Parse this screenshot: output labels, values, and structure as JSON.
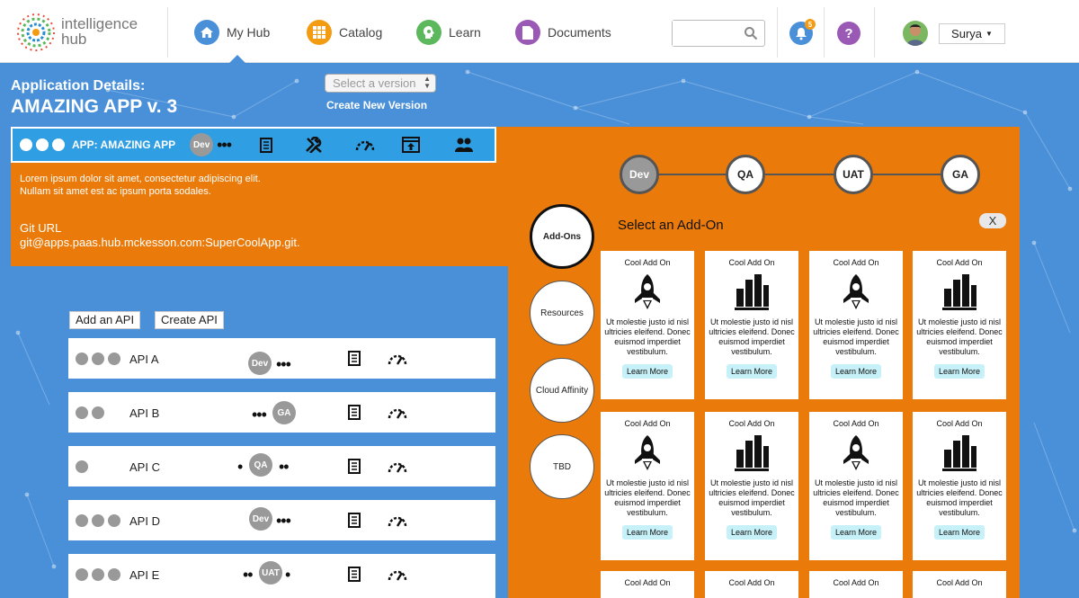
{
  "brand": {
    "line1": "intelligence",
    "line2": "hub"
  },
  "nav": [
    {
      "label": "My Hub",
      "icon": "home-icon",
      "color": "#4a90d9"
    },
    {
      "label": "Catalog",
      "icon": "grid-icon",
      "color": "#f39c12"
    },
    {
      "label": "Learn",
      "icon": "head-icon",
      "color": "#5cb85c"
    },
    {
      "label": "Documents",
      "icon": "document-icon",
      "color": "#9b59b6"
    }
  ],
  "search": {
    "placeholder": ""
  },
  "notifications": {
    "count": "5"
  },
  "user": {
    "name": "Surya"
  },
  "app": {
    "label": "Application Details:",
    "title": "AMAZING APP v. 3",
    "version_select": "Select a version",
    "create_version": "Create New Version",
    "bar_label": "APP: AMAZING APP",
    "stage": "Dev",
    "description": "Lorem ipsum dolor sit amet, consectetur adipiscing elit. Nullam sit amet est ac ipsum porta sodales.",
    "git_label": "Git URL",
    "git_url": "git@apps.paas.hub.mckesson.com:SuperCoolApp.git."
  },
  "api_actions": {
    "add": "Add an API",
    "create": "Create API"
  },
  "apis": [
    {
      "name": "API A",
      "stage": "Dev"
    },
    {
      "name": "API B",
      "stage": "GA"
    },
    {
      "name": "API C",
      "stage": "QA"
    },
    {
      "name": "API D",
      "stage": "Dev"
    },
    {
      "name": "API E",
      "stage": "UAT"
    }
  ],
  "pipeline": [
    "Dev",
    "QA",
    "UAT",
    "GA"
  ],
  "side_tabs": [
    "Add-Ons",
    "Resources",
    "Cloud Affinity",
    "TBD"
  ],
  "addons": {
    "title": "Select an Add-On",
    "close": "X",
    "card_title": "Cool Add On",
    "card_desc": "Ut molestie justo id nisl ultricies eleifend. Donec euismod imperdiet vestibulum.",
    "learn_more": "Learn More"
  },
  "colors": {
    "blue": "#4a90d9",
    "orange": "#ea7b0b",
    "app_bar": "#2f9ee3",
    "learn_more": "#c7f1f8"
  }
}
